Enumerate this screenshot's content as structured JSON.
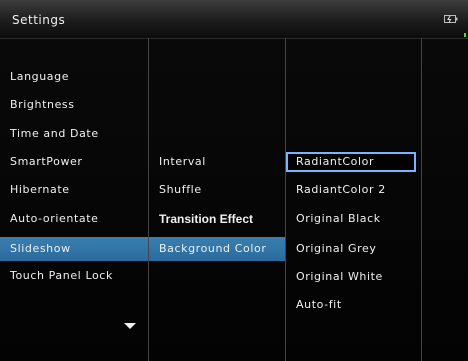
{
  "header": {
    "title": "Settings",
    "status_icon": "battery-charging-icon"
  },
  "main_menu": {
    "items": [
      {
        "label": "Language"
      },
      {
        "label": "Brightness"
      },
      {
        "label": "Time and Date"
      },
      {
        "label": "SmartPower"
      },
      {
        "label": "Hibernate"
      },
      {
        "label": "Auto-orientate"
      },
      {
        "label": "Slideshow",
        "selected": true
      },
      {
        "label": "Touch Panel Lock"
      }
    ],
    "scroll_icon": "chevron-down-icon"
  },
  "slideshow_menu": {
    "items": [
      {
        "label": "Interval"
      },
      {
        "label": "Shuffle"
      },
      {
        "label": "Transition Effect"
      },
      {
        "label": "Background Color",
        "selected": true
      }
    ]
  },
  "background_color_menu": {
    "items": [
      {
        "label": "RadiantColor",
        "focused": true
      },
      {
        "label": "RadiantColor 2"
      },
      {
        "label": "Original Black"
      },
      {
        "label": "Original Grey"
      },
      {
        "label": "Original White"
      },
      {
        "label": "Auto-fit"
      }
    ]
  },
  "colors": {
    "selection": "#2f74a8",
    "focus_border": "#7ab3ff",
    "status_indicator": "#4fd34f"
  }
}
